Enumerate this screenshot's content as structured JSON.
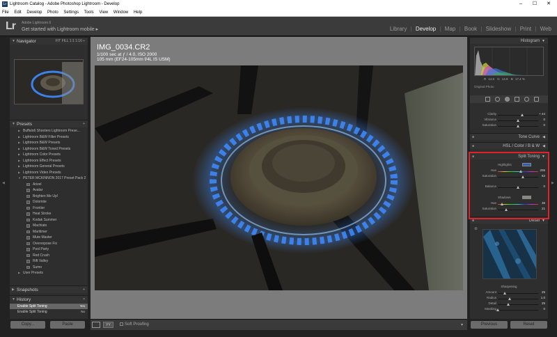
{
  "window": {
    "title": "Lightroom Catalog - Adobe Photoshop Lightroom - Develop",
    "controls": {
      "minimize": "–",
      "maximize": "☐",
      "close": "✕"
    }
  },
  "menubar": [
    "File",
    "Edit",
    "Develop",
    "Photo",
    "Settings",
    "Tools",
    "View",
    "Window",
    "Help"
  ],
  "identity": {
    "logo": "Lr",
    "product": "Adobe Lightroom 6",
    "tagline": "Get started with Lightroom mobile ▸",
    "modules": [
      "Library",
      "Develop",
      "Map",
      "Book",
      "Slideshow",
      "Print",
      "Web"
    ],
    "active_module": "Develop",
    "separator": "|"
  },
  "navigator": {
    "title": "Navigator",
    "zoom_options": "FIT  FILL  1:1  1:16 ÷"
  },
  "presets": {
    "title": "Presets",
    "add": "+",
    "folders": [
      "Buffalo6 Shooters Lightroom Prese...",
      "Lightroom B&W Filter Presets",
      "Lightroom B&W Presets",
      "Lightroom B&W Toned Presets",
      "Lightroom Color Presets",
      "Lightroom Effect Presets",
      "Lightroom General Presets",
      "Lightroom Video Presets",
      "PETER MCKINNON 2017 Preset Pack 2"
    ],
    "items": [
      "Arizel",
      "Avatar",
      "Brighten Me Up!",
      "Dolomite",
      "Frontier",
      "Heat Stroke",
      "Kodak Summer",
      "Machiato",
      "Maritimer",
      "Mute Master",
      "Overexpose Fix",
      "Pool Party",
      "Red Crush",
      "Rift Valley",
      "Sumo"
    ],
    "user_presets": "User Presets"
  },
  "snapshots": {
    "title": "Snapshots",
    "add": "+"
  },
  "history": {
    "title": "History",
    "clear": "×",
    "rows": [
      {
        "label": "Enable Split Toning",
        "value": "Yes"
      },
      {
        "label": "Enable Split Toning",
        "value": "No"
      }
    ]
  },
  "left_buttons": {
    "copy": "Copy...",
    "paste": "Paste"
  },
  "photo_info": {
    "filename": "IMG_0034.CR2",
    "line1": "1/100 sec at ƒ / 4.0, ISO 2000",
    "line2": "105 mm (EF24-105mm f/4L IS USM)"
  },
  "toolbar": {
    "yy_label": "YY",
    "soft_proofing": "Soft Proofing",
    "menu": "▾"
  },
  "histogram": {
    "title": "Histogram",
    "readout": {
      "r": "R",
      "r_val": "14.6",
      "g": "G",
      "g_val": "14.9",
      "b": "B",
      "b_val": "17.4 %"
    },
    "original_photo": "Original Photo"
  },
  "basic_partial": [
    {
      "label": "Clarity",
      "value": "+ 44",
      "pos": 0.61
    },
    {
      "label": "Vibrance",
      "value": "0",
      "pos": 0.5
    },
    {
      "label": "Saturation",
      "value": "0",
      "pos": 0.5
    }
  ],
  "tone_curve": {
    "title": "Tone Curve"
  },
  "hsl": {
    "title": "HSL / Color / B & W"
  },
  "split_toning": {
    "title": "Split Toning",
    "highlights_label": "Highlights",
    "highlights_color": "#2e5fb3",
    "highlights": [
      {
        "label": "Hue",
        "value": "206",
        "pos": 0.57
      },
      {
        "label": "Saturation",
        "value": "62",
        "pos": 0.62
      }
    ],
    "balance": {
      "label": "Balance",
      "value": "0",
      "pos": 0.5
    },
    "shadows_label": "Shadows",
    "shadows_color": "#8a877c",
    "shadows": [
      {
        "label": "Hue",
        "value": "36",
        "pos": 0.1
      },
      {
        "label": "Saturation",
        "value": "21",
        "pos": 0.21
      }
    ]
  },
  "detail": {
    "title": "Detail",
    "sharpening_label": "Sharpening",
    "sharpening": [
      {
        "label": "Amount",
        "value": "25",
        "pos": 0.17
      },
      {
        "label": "Radius",
        "value": "1.0",
        "pos": 0.3
      },
      {
        "label": "Detail",
        "value": "25",
        "pos": 0.25
      },
      {
        "label": "Masking",
        "value": "0",
        "pos": 0.0
      }
    ]
  },
  "right_buttons": {
    "previous": "Previous",
    "reset": "Reset"
  },
  "colors": {
    "highlight_box": "#e1222a",
    "flame_blue": "#3f8cff"
  }
}
